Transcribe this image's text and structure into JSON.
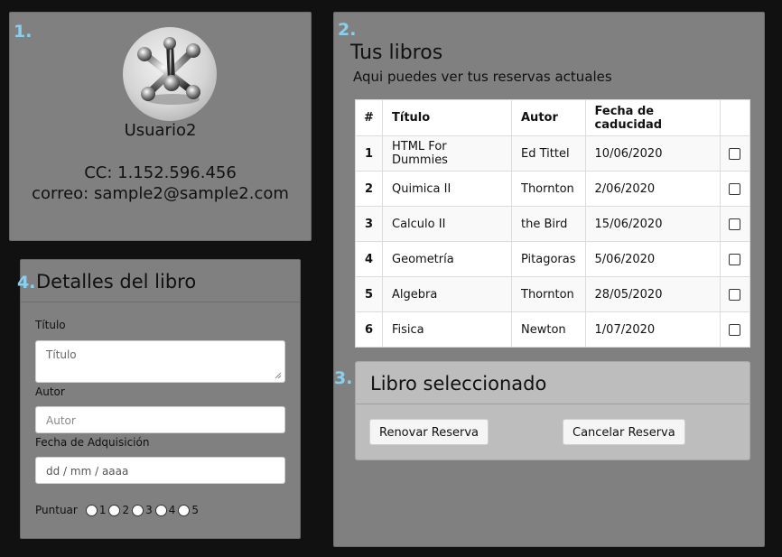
{
  "profile": {
    "section_number": "1.",
    "username": "Usuario2",
    "cc": "CC: 1.152.596.456",
    "email": "correo: sample2@sample2.com"
  },
  "books": {
    "section_number": "2.",
    "title": "Tus libros",
    "subtitle": "Aqui puedes ver tus reservas actuales",
    "columns": [
      "#",
      "Título",
      "Autor",
      "Fecha de caducidad"
    ],
    "rows": [
      {
        "num": "1",
        "title": "HTML For Dummies",
        "author": "Ed Tittel",
        "date": "10/06/2020"
      },
      {
        "num": "2",
        "title": "Quimica II",
        "author": "Thornton",
        "date": "2/06/2020"
      },
      {
        "num": "3",
        "title": "Calculo II",
        "author": "the Bird",
        "date": "15/06/2020"
      },
      {
        "num": "4",
        "title": "Geometría",
        "author": "Pitagoras",
        "date": "5/06/2020"
      },
      {
        "num": "5",
        "title": "Algebra",
        "author": "Thornton",
        "date": "28/05/2020"
      },
      {
        "num": "6",
        "title": "Fisica",
        "author": "Newton",
        "date": "1/07/2020"
      }
    ]
  },
  "selected": {
    "section_number": "3.",
    "title": "Libro seleccionado",
    "renew_label": "Renovar Reserva",
    "cancel_label": "Cancelar Reserva"
  },
  "details": {
    "section_number": "4.",
    "title": "Detalles del libro",
    "title_label": "Título",
    "title_placeholder": "Título",
    "author_label": "Autor",
    "author_placeholder": "Autor",
    "date_label": "Fecha de Adquisición",
    "date_placeholder": "dd / mm / aaaa",
    "rating_label": "Puntuar",
    "rating_options": [
      "1",
      "2",
      "3",
      "4",
      "5"
    ]
  },
  "colors": {
    "background": "#111111",
    "panel": "#808080",
    "section_number": "#8ad0ee",
    "card": "#bdbdbd"
  }
}
